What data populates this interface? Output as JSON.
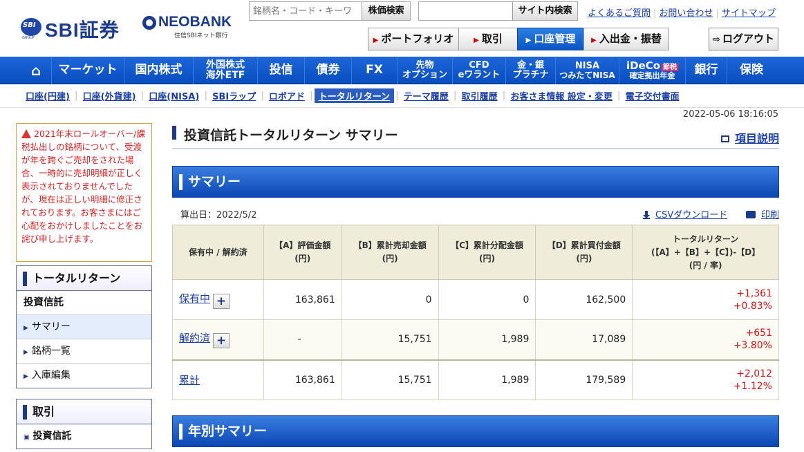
{
  "header": {
    "sbi_logo_text": "SBI証券",
    "sbi_group_text": "GROUP",
    "neobank_logo": "NEOBANK",
    "neobank_sub": "住信SBIネット銀行",
    "stock_search_placeholder": "銘柄名・コード・キーワ",
    "stock_search_button": "株価検索",
    "site_search_placeholder": "",
    "site_search_button": "サイト内検索",
    "links": [
      "よくあるご質問",
      "お問い合わせ",
      "サイトマップ"
    ],
    "tabs": [
      "ポートフォリオ",
      "取引",
      "口座管理",
      "入出金・振替"
    ],
    "active_tab": "口座管理",
    "logout_label": "ログアウト"
  },
  "nav": {
    "items": [
      {
        "label": "マーケット"
      },
      {
        "label": "国内株式"
      },
      {
        "label": "外国株式",
        "label2": "海外ETF"
      },
      {
        "label": "投信"
      },
      {
        "label": "債券"
      },
      {
        "label": "FX"
      },
      {
        "label": "先物",
        "label2": "オプション"
      },
      {
        "label": "CFD",
        "label2": "eワラント"
      },
      {
        "label": "金・銀",
        "label2": "プラチナ"
      },
      {
        "label": "NISA",
        "label2": "つみたてNISA"
      },
      {
        "label": "iDeCo",
        "badge": "節税",
        "label2": "確定拠出年金"
      },
      {
        "label": "銀行"
      },
      {
        "label": "保険"
      }
    ]
  },
  "subnav": {
    "items": [
      "口座(円建)",
      "口座(外貨建)",
      "口座(NISA)",
      "SBIラップ",
      "ロボアド",
      "トータルリターン",
      "テーマ履歴",
      "取引履歴",
      "お客さま情報 設定・変更",
      "電子交付書面"
    ],
    "active": "トータルリターン"
  },
  "datetime": "2022-05-06 18:16:05",
  "notice": "2021年末ロールオーバー/課税払出しの銘柄について、受渡が年を跨ぐご売却をされた場合、一時的に売却明細が正しく表示されておりませんでしたが、現在は正しい明細に修正されております。お客さまにはご心配をおかけしましたことをお詫び申し上げます。",
  "sidebar": {
    "box1_title": "トータルリターン",
    "box1_category": "投資信託",
    "box1_items": [
      "サマリー",
      "銘柄一覧",
      "入庫編集"
    ],
    "box1_selected": "サマリー",
    "box2_title": "取引",
    "box2_item": "投資信託"
  },
  "main": {
    "page_title": "投資信託トータルリターン サマリー",
    "help_link": "項目説明",
    "summary_banner": "サマリー",
    "calc_date": "算出日：2022/5/2",
    "csv_link": "CSVダウンロード",
    "print_link": "印刷",
    "yearly_banner": "年別サマリー"
  },
  "table": {
    "headers": {
      "h0": "保有中 / 解約済",
      "h1a": "【A】評価金額",
      "h1b": "(円)",
      "h2a": "【B】累計売却金額",
      "h2b": "(円)",
      "h3a": "【C】累計分配金額",
      "h3b": "(円)",
      "h4a": "【D】累計買付金額",
      "h4b": "(円)",
      "h5a": "トータルリターン",
      "h5b": "(【A】+【B】+【C】)-【D】",
      "h5c": "(円 / 率)"
    },
    "rows": [
      {
        "label": "保有中",
        "a": "163,861",
        "b": "0",
        "c": "0",
        "d": "162,500",
        "ret": "+1,361",
        "rate": "+0.83%"
      },
      {
        "label": "解約済",
        "a": "-",
        "b": "15,751",
        "c": "1,989",
        "d": "17,089",
        "ret": "+651",
        "rate": "+3.80%"
      },
      {
        "label": "累計",
        "a": "163,861",
        "b": "15,751",
        "c": "1,989",
        "d": "179,589",
        "ret": "+2,012",
        "rate": "+1.12%"
      }
    ]
  },
  "colors": {
    "nav_blue": "#0a4ec0",
    "return_red": "#e01010",
    "link_blue": "#1a3ea8"
  }
}
